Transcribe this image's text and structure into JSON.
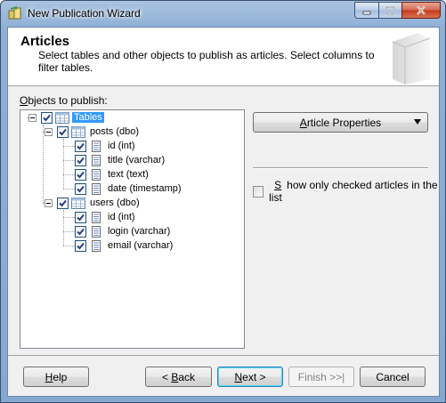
{
  "window": {
    "title": "New Publication Wizard",
    "minimize_glyph": "minimize-icon",
    "maximize_glyph": "maximize-icon",
    "close_glyph": "close-icon"
  },
  "header": {
    "title": "Articles",
    "description": "Select tables and other objects to publish as articles. Select columns to filter tables."
  },
  "objects_label": "Objects to publish:",
  "tree": {
    "root": {
      "label": "Tables",
      "checked": true,
      "selected": true
    },
    "tables": [
      {
        "label": "posts (dbo)",
        "checked": true,
        "columns": [
          {
            "label": "id (int)",
            "checked": true
          },
          {
            "label": "title (varchar)",
            "checked": true
          },
          {
            "label": "text (text)",
            "checked": true
          },
          {
            "label": "date (timestamp)",
            "checked": true
          }
        ]
      },
      {
        "label": "users (dbo)",
        "checked": true,
        "columns": [
          {
            "label": "id (int)",
            "checked": true
          },
          {
            "label": "login (varchar)",
            "checked": true
          },
          {
            "label": "email (varchar)",
            "checked": true
          }
        ]
      }
    ]
  },
  "article_properties_label": "Article Properties",
  "show_only_checked": {
    "label": "Show only checked articles in the list",
    "checked": false
  },
  "footer": {
    "help": "Help",
    "back": "< Back",
    "next": "Next >",
    "finish": "Finish >>|",
    "cancel": "Cancel"
  },
  "colors": {
    "selection": "#3399ff",
    "title_bar": "#8fb0d6",
    "close_button": "#c4391c"
  }
}
